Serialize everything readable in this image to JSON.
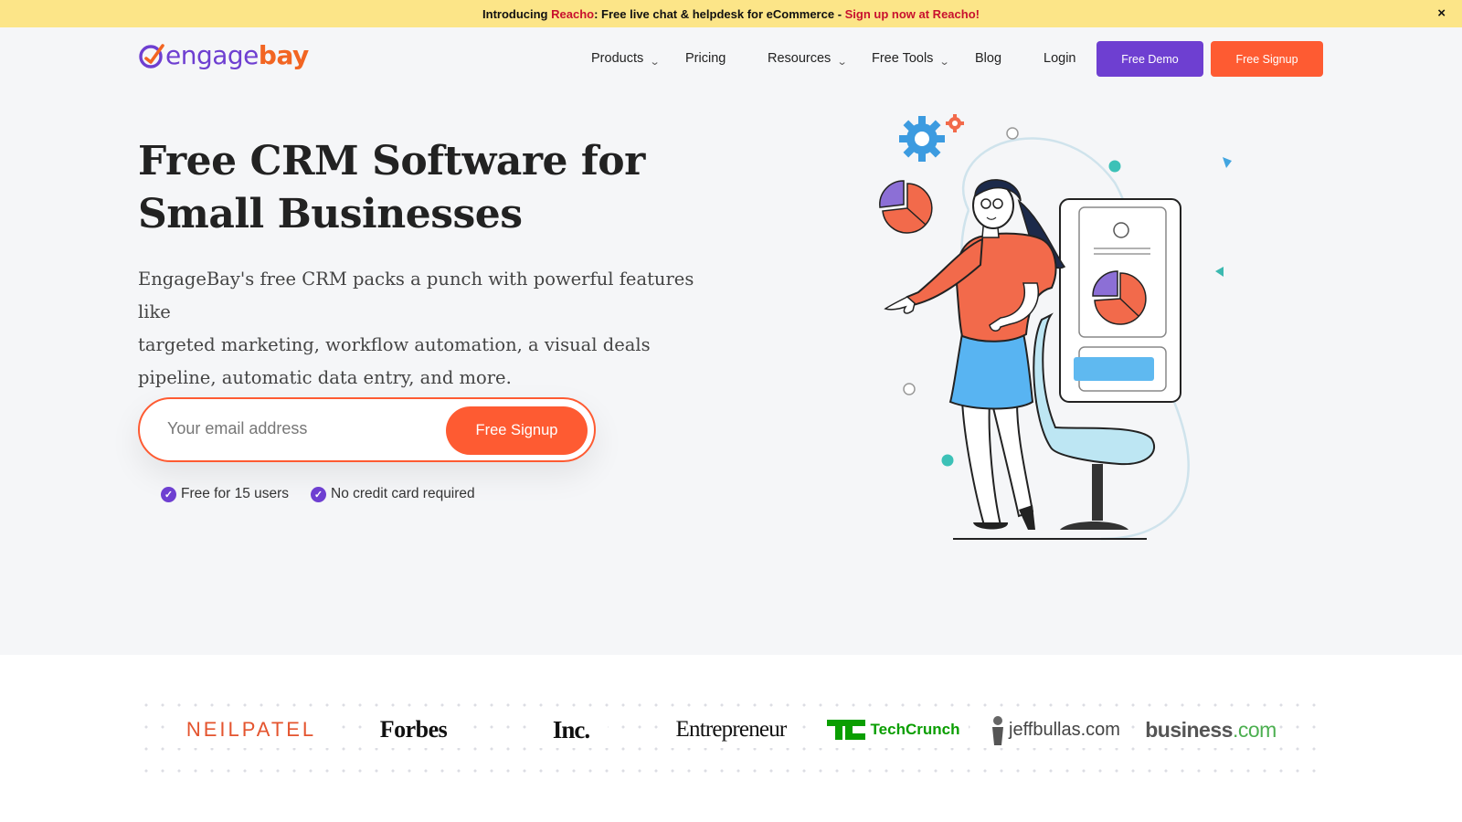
{
  "announcement": {
    "prefix": "Introducing ",
    "brand": "Reacho",
    "middle": ": Free live chat & helpdesk for eCommerce - ",
    "cta": "Sign up now at Reacho!",
    "close": "×"
  },
  "header": {
    "logo": {
      "part1": "engage",
      "part2": "bay"
    },
    "nav": [
      {
        "label": "Products",
        "has_dropdown": true
      },
      {
        "label": "Pricing",
        "has_dropdown": false
      },
      {
        "label": "Resources",
        "has_dropdown": true
      },
      {
        "label": "Free Tools",
        "has_dropdown": true
      },
      {
        "label": "Blog",
        "has_dropdown": false
      },
      {
        "label": "Login",
        "has_dropdown": false
      }
    ],
    "demo_button": "Free Demo",
    "signup_button": "Free Signup"
  },
  "hero": {
    "title_line1": "Free CRM Software for",
    "title_line2": "Small Businesses",
    "description_line1": "EngageBay's free CRM packs a punch with powerful features like",
    "description_line2": "targeted marketing, workflow automation, a visual deals",
    "description_line3": "pipeline, automatic data entry, and more.",
    "email_placeholder": "Your email address",
    "signup_button": "Free Signup",
    "perks": [
      "Free for 15 users",
      "No credit card required"
    ]
  },
  "press": {
    "logos": [
      "NEILPATEL",
      "Forbes",
      "Inc.",
      "Entrepreneur",
      "TechCrunch",
      "jeffbullas.com",
      "business",
      ".com"
    ]
  },
  "colors": {
    "announcement_bg": "#fce588",
    "accent_red": "#c8102e",
    "brand_purple": "#6e3fd1",
    "brand_orange": "#fe5b32",
    "page_bg": "#f5f6f8"
  },
  "icons": {
    "close": "close-icon",
    "dropdown": "chevron-down-icon",
    "check": "check-circle-icon"
  }
}
